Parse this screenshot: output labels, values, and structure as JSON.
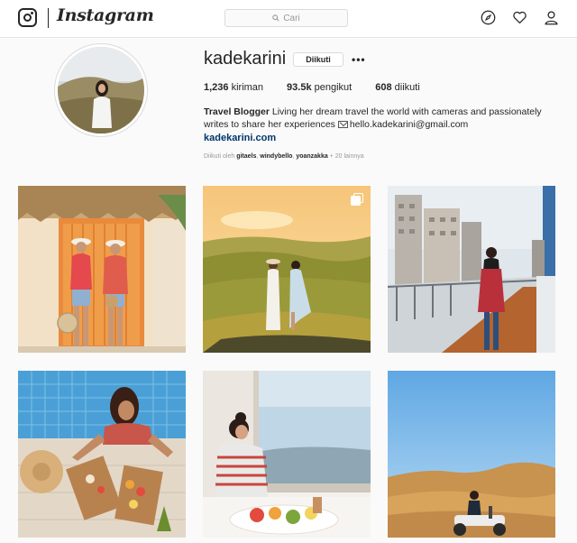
{
  "header": {
    "brand": "Instagram",
    "search_placeholder": "Cari",
    "icons": [
      "instagram-glyph-icon",
      "compass-icon",
      "heart-icon",
      "person-icon"
    ]
  },
  "profile": {
    "username": "kadekarini",
    "follow_button": "Diikuti",
    "more_button": "•••",
    "stats": [
      {
        "count": "1,236",
        "label": "kiriman"
      },
      {
        "count": "93.5k",
        "label": "pengikut"
      },
      {
        "count": "608",
        "label": "diikuti"
      }
    ],
    "bio_title": "Travel Blogger",
    "bio_text": " Living her dream travel the world with cameras and passionately writes to share her experiences ",
    "bio_email": "hello.kadekarini@gmail.com",
    "website": "kadekarini.com",
    "followed_by_prefix": "Diikuti oleh ",
    "followed_by_names": [
      "gitaels",
      "windybello",
      "yoanzakka"
    ],
    "followed_by_suffix": " + 20 lainnya"
  },
  "posts": [
    {
      "label": "post-two-women-at-door",
      "multi": false
    },
    {
      "label": "post-hills-sunset",
      "multi": true
    },
    {
      "label": "post-bridge-city",
      "multi": false
    },
    {
      "label": "post-pool-breakfast",
      "multi": false
    },
    {
      "label": "post-window-breakfast",
      "multi": false
    },
    {
      "label": "post-savanna-scooter",
      "multi": false
    }
  ]
}
